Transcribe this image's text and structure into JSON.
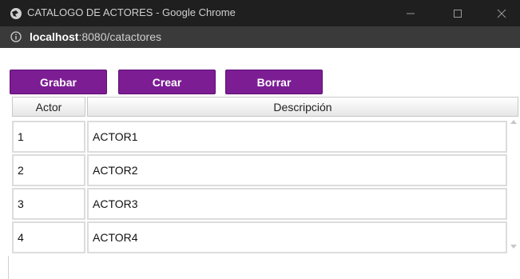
{
  "window": {
    "title": "CATALOGO DE ACTORES - Google Chrome",
    "url_host": "localhost",
    "url_rest": ":8080/catactores"
  },
  "toolbar": {
    "grabar_label": "Grabar",
    "crear_label": "Crear",
    "borrar_label": "Borrar"
  },
  "grid": {
    "columns": [
      "Actor",
      "Descripción"
    ],
    "rows": [
      {
        "actor": "1",
        "descripcion": "ACTOR1"
      },
      {
        "actor": "2",
        "descripcion": "ACTOR2"
      },
      {
        "actor": "3",
        "descripcion": "ACTOR3"
      },
      {
        "actor": "4",
        "descripcion": "ACTOR4"
      }
    ]
  },
  "icons": {
    "page": "globe-icon",
    "info": "info-icon",
    "minimize": "minimize-icon",
    "maximize": "maximize-icon",
    "close": "close-icon"
  },
  "colors": {
    "titlebar": "#1f1f1f",
    "addressbar": "#3a3a3a",
    "button": "#7c1d94"
  }
}
